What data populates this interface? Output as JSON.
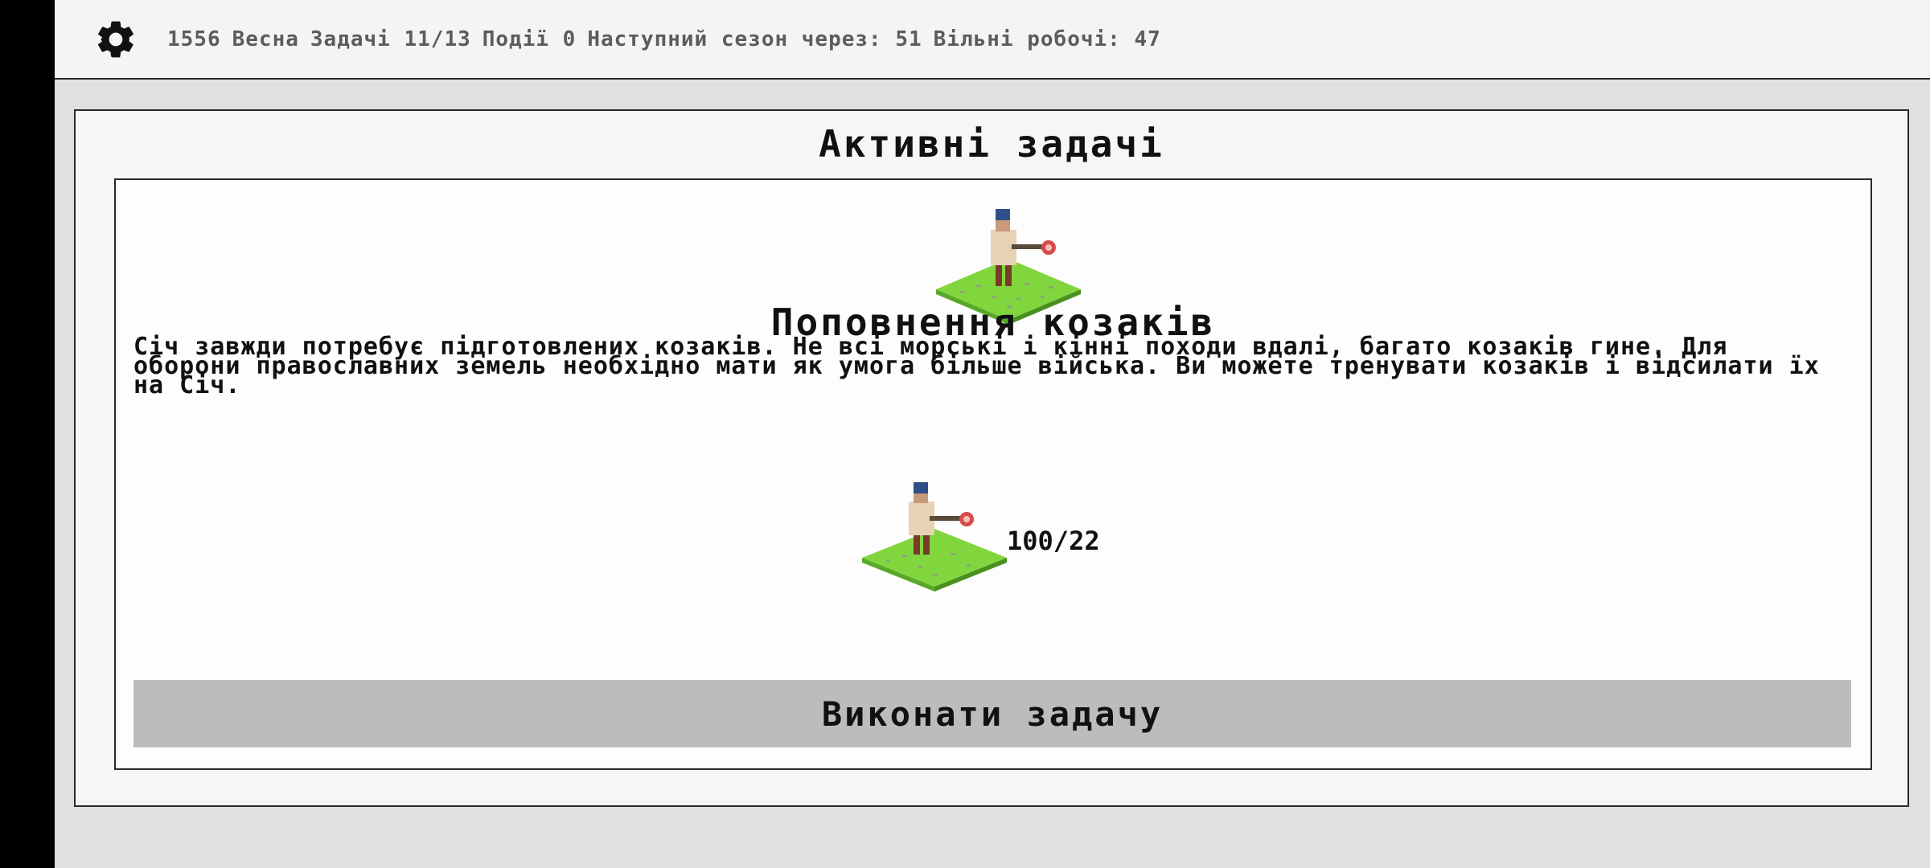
{
  "status_bar": {
    "year": "1556",
    "season": "Весна",
    "tasks": "Задачі 11/13",
    "events": "Події 0",
    "next_season": "Наступний сезон через: 51",
    "free_workers": "Вільні робочі: 47"
  },
  "icons": {
    "settings": "gear-icon",
    "task_image": "cossack-tile-icon",
    "requirement_image": "cossack-tile-icon"
  },
  "panel": {
    "title": "Активні задачі"
  },
  "task": {
    "title": "Поповнення козаків",
    "description": "Січ завжди потребує підготовлених козаків. Не всі морські і кінні походи вдалі, багато козаків гине. Для оборони православних земель необхідно мати як умога більше війська. Ви можете тренувати козаків і відсилати їх на Січ.",
    "requirement_count": "100/22",
    "action_label": "Виконати задачу"
  },
  "colors": {
    "background": "#e0e0e0",
    "button": "#bcbcbc",
    "grass": "#7fd43a"
  }
}
